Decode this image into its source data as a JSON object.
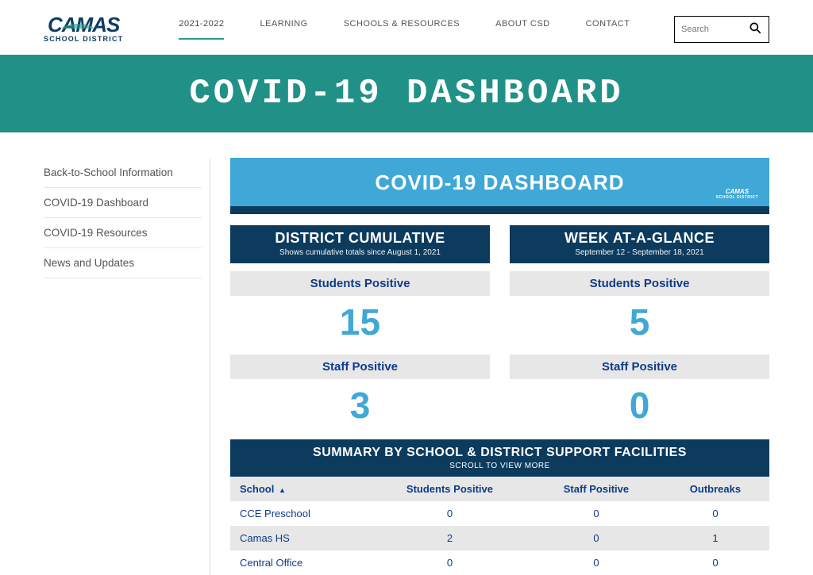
{
  "logo": {
    "main": "CAMAS",
    "sub": "SCHOOL DISTRICT"
  },
  "nav": {
    "items": [
      "2021-2022",
      "LEARNING",
      "SCHOOLS & RESOURCES",
      "ABOUT CSD",
      "CONTACT"
    ],
    "active_index": 0
  },
  "search": {
    "placeholder": "Search"
  },
  "hero": {
    "title": "COVID-19 DASHBOARD"
  },
  "sidebar": {
    "items": [
      "Back-to-School Information",
      "COVID-19 Dashboard",
      "COVID-19 Resources",
      "News and Updates"
    ]
  },
  "dashboard": {
    "header_title": "COVID-19 DASHBOARD",
    "header_logo": {
      "main": "CAMAS",
      "sub": "SCHOOL DISTRICT"
    },
    "columns": [
      {
        "title": "DISTRICT CUMULATIVE",
        "subtitle": "Shows cumulative totals since August 1, 2021",
        "metrics": [
          {
            "label": "Students Positive",
            "value": "15"
          },
          {
            "label": "Staff Positive",
            "value": "3"
          }
        ]
      },
      {
        "title": "WEEK AT-A-GLANCE",
        "subtitle": "September 12 - September 18, 2021",
        "metrics": [
          {
            "label": "Students Positive",
            "value": "5"
          },
          {
            "label": "Staff Positive",
            "value": "0"
          }
        ]
      }
    ],
    "summary": {
      "title": "SUMMARY BY SCHOOL & DISTRICT SUPPORT FACILITIES",
      "subtitle": "SCROLL TO VIEW MORE",
      "headers": [
        "School",
        "Students Positive",
        "Staff Positive",
        "Outbreaks"
      ],
      "sort_indicator": "▲",
      "rows": [
        {
          "cells": [
            "CCE Preschool",
            "0",
            "0",
            "0"
          ],
          "alt": false
        },
        {
          "cells": [
            "Camas HS",
            "2",
            "0",
            "1"
          ],
          "alt": true
        },
        {
          "cells": [
            "Central Office",
            "0",
            "0",
            "0"
          ],
          "alt": false
        }
      ]
    }
  },
  "chart_data": {
    "type": "table",
    "title": "COVID-19 Dashboard — Summary by School & District Support Facilities",
    "columns": [
      "School",
      "Students Positive",
      "Staff Positive",
      "Outbreaks"
    ],
    "rows": [
      [
        "CCE Preschool",
        0,
        0,
        0
      ],
      [
        "Camas HS",
        2,
        0,
        1
      ],
      [
        "Central Office",
        0,
        0,
        0
      ]
    ],
    "totals": {
      "district_cumulative": {
        "students_positive": 15,
        "staff_positive": 3,
        "since": "August 1, 2021"
      },
      "week_at_a_glance": {
        "students_positive": 5,
        "staff_positive": 0,
        "range": "September 12 - September 18, 2021"
      }
    }
  }
}
